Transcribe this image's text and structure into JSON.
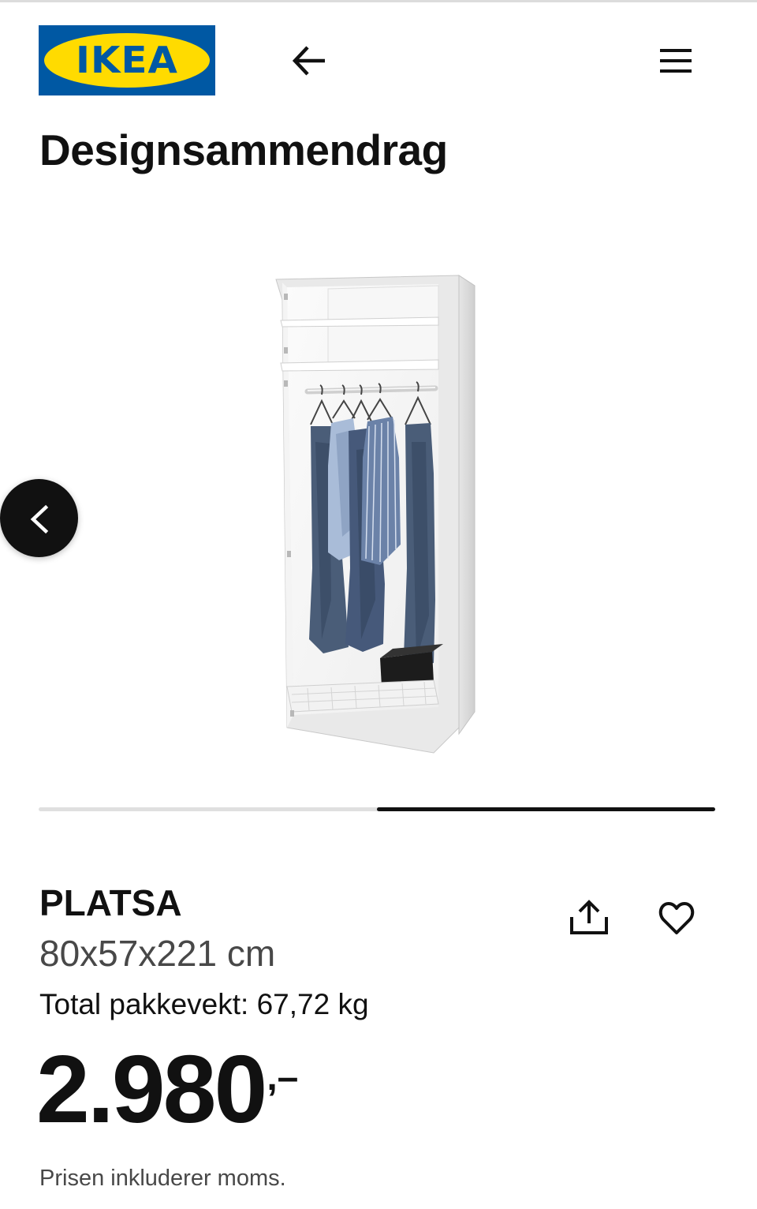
{
  "header": {
    "logo_text": "IKEA",
    "logo_reg": "®",
    "back_icon": "arrow-left-icon",
    "menu_icon": "hamburger-menu-icon"
  },
  "page": {
    "title": "Designsammendrag"
  },
  "carousel": {
    "image_alt": "PLATSA garderobe med kleshenger, hyller og trådkurv",
    "prev_icon": "chevron-left-icon",
    "slide_count": 2,
    "active_slide": 2
  },
  "product": {
    "name": "PLATSA",
    "dimensions": "80x57x221 cm",
    "weight": "Total pakkevekt: 67,72 kg",
    "price_integer": "2.980",
    "price_suffix": ",–",
    "vat_note": "Prisen inkluderer moms.",
    "share_icon": "share-icon",
    "favorite_icon": "heart-icon"
  },
  "colors": {
    "brand_blue": "#0058a3",
    "brand_yellow": "#ffdb00",
    "text": "#111111",
    "muted_text": "#484848",
    "track": "#dfdfdf"
  }
}
